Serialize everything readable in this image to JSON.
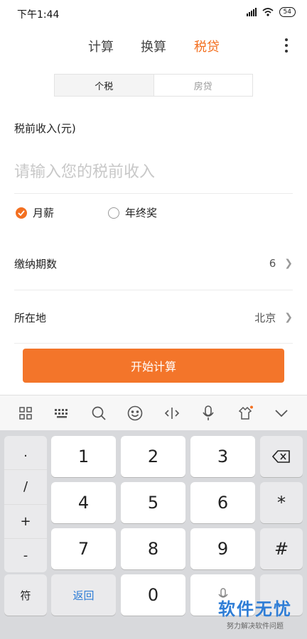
{
  "status_bar": {
    "time": "下午1:44",
    "battery": "54"
  },
  "tabs": [
    {
      "label": "计算",
      "active": false
    },
    {
      "label": "换算",
      "active": false
    },
    {
      "label": "税贷",
      "active": true
    }
  ],
  "segments": {
    "selected": "个税",
    "other": "房贷"
  },
  "form": {
    "income_label": "税前收入(元)",
    "income_placeholder": "请输入您的税前收入",
    "income_value": "",
    "radio_monthly": "月薪",
    "radio_yearend": "年终奖",
    "period_label": "缴纳期数",
    "period_value": "6",
    "location_label": "所在地",
    "location_value": "北京"
  },
  "start_button": "开始计算",
  "keyboard": {
    "symbols": [
      ".",
      "/",
      "+",
      "-"
    ],
    "digits": [
      "1",
      "2",
      "3",
      "4",
      "5",
      "6",
      "7",
      "8",
      "9",
      "0"
    ],
    "star": "*",
    "hash": "#",
    "symbol_key": "符",
    "return_key": "返回"
  },
  "watermark": {
    "main": "软件无忧",
    "sub": "努力解决软件问题"
  },
  "colors": {
    "accent": "#f37021",
    "button": "#f3752a",
    "watermark": "#2e7dd6"
  }
}
